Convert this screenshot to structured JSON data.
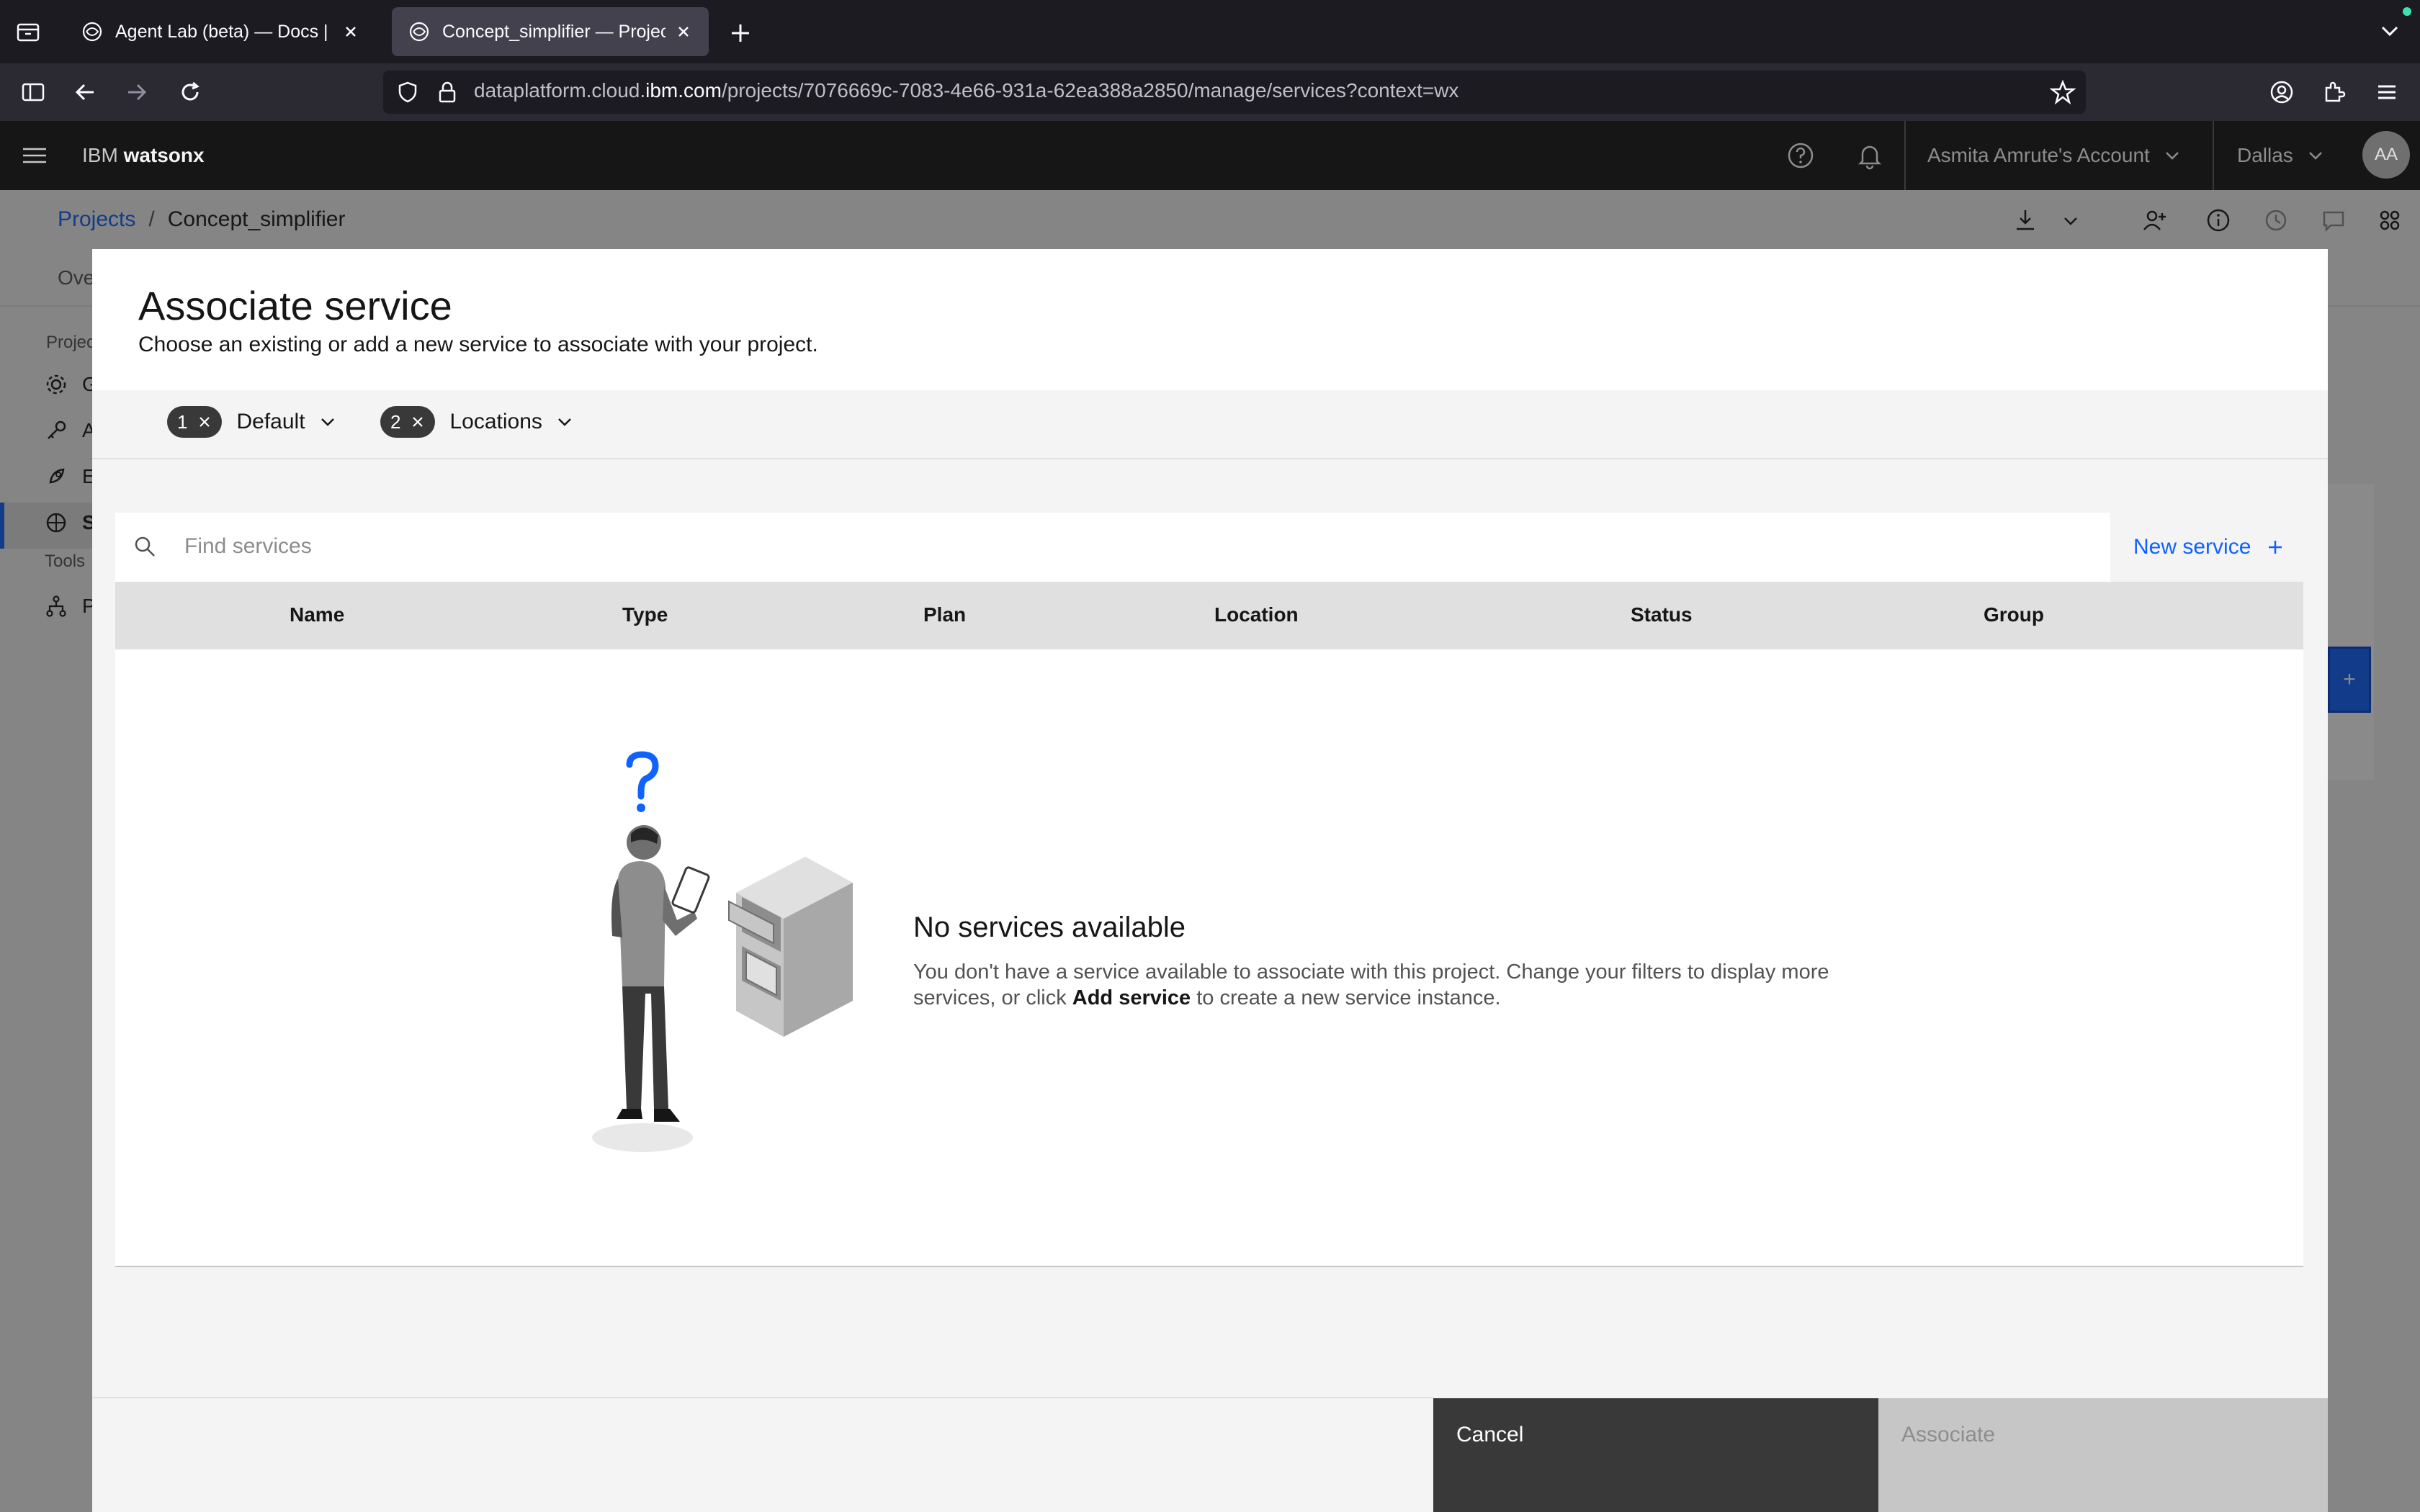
{
  "browser": {
    "tabs": [
      {
        "title": "Agent Lab (beta) — Docs | IBM watsonx",
        "active": false
      },
      {
        "title": "Concept_simplifier — Projects | IBM watsonx",
        "active": true
      }
    ],
    "url_prefix": "dataplatform.cloud.",
    "url_domain": "ibm.com",
    "url_path": "/projects/7076669c-7083-4e66-931a-62ea388a2850/manage/services?context=wx"
  },
  "header": {
    "brand_prefix": "IBM ",
    "brand_name": "watsonx",
    "account": "Asmita Amrute's Account",
    "region": "Dallas",
    "avatar": "AA"
  },
  "page": {
    "breadcrumb_root": "Projects",
    "breadcrumb_sep": "/",
    "breadcrumb_current": "Concept_simplifier",
    "tab_partial": "Ove",
    "side_section": "Projec",
    "side_items": [
      "G",
      "A",
      "E",
      "S"
    ],
    "tools_label": "Tools",
    "tools_item": "P"
  },
  "modal": {
    "title": "Associate service",
    "subtitle": "Choose an existing or add a new service to associate with your project.",
    "filters": [
      {
        "count": "1",
        "label": "Default"
      },
      {
        "count": "2",
        "label": "Locations"
      }
    ],
    "search_placeholder": "Find services",
    "new_service_label": "New service",
    "columns": [
      "Name",
      "Type",
      "Plan",
      "Location",
      "Status",
      "Group"
    ],
    "empty_title": "No services available",
    "empty_text_1": "You don't have a service available to associate with this project. Change your filters to display more services, or click ",
    "empty_text_bold": "Add service",
    "empty_text_2": " to create a new service instance.",
    "cancel_label": "Cancel",
    "associate_label": "Associate"
  },
  "colors": {
    "accent": "#0f62fe",
    "header_bg": "#161616",
    "cancel_bg": "#393939",
    "disabled_bg": "#c6c6c6"
  }
}
